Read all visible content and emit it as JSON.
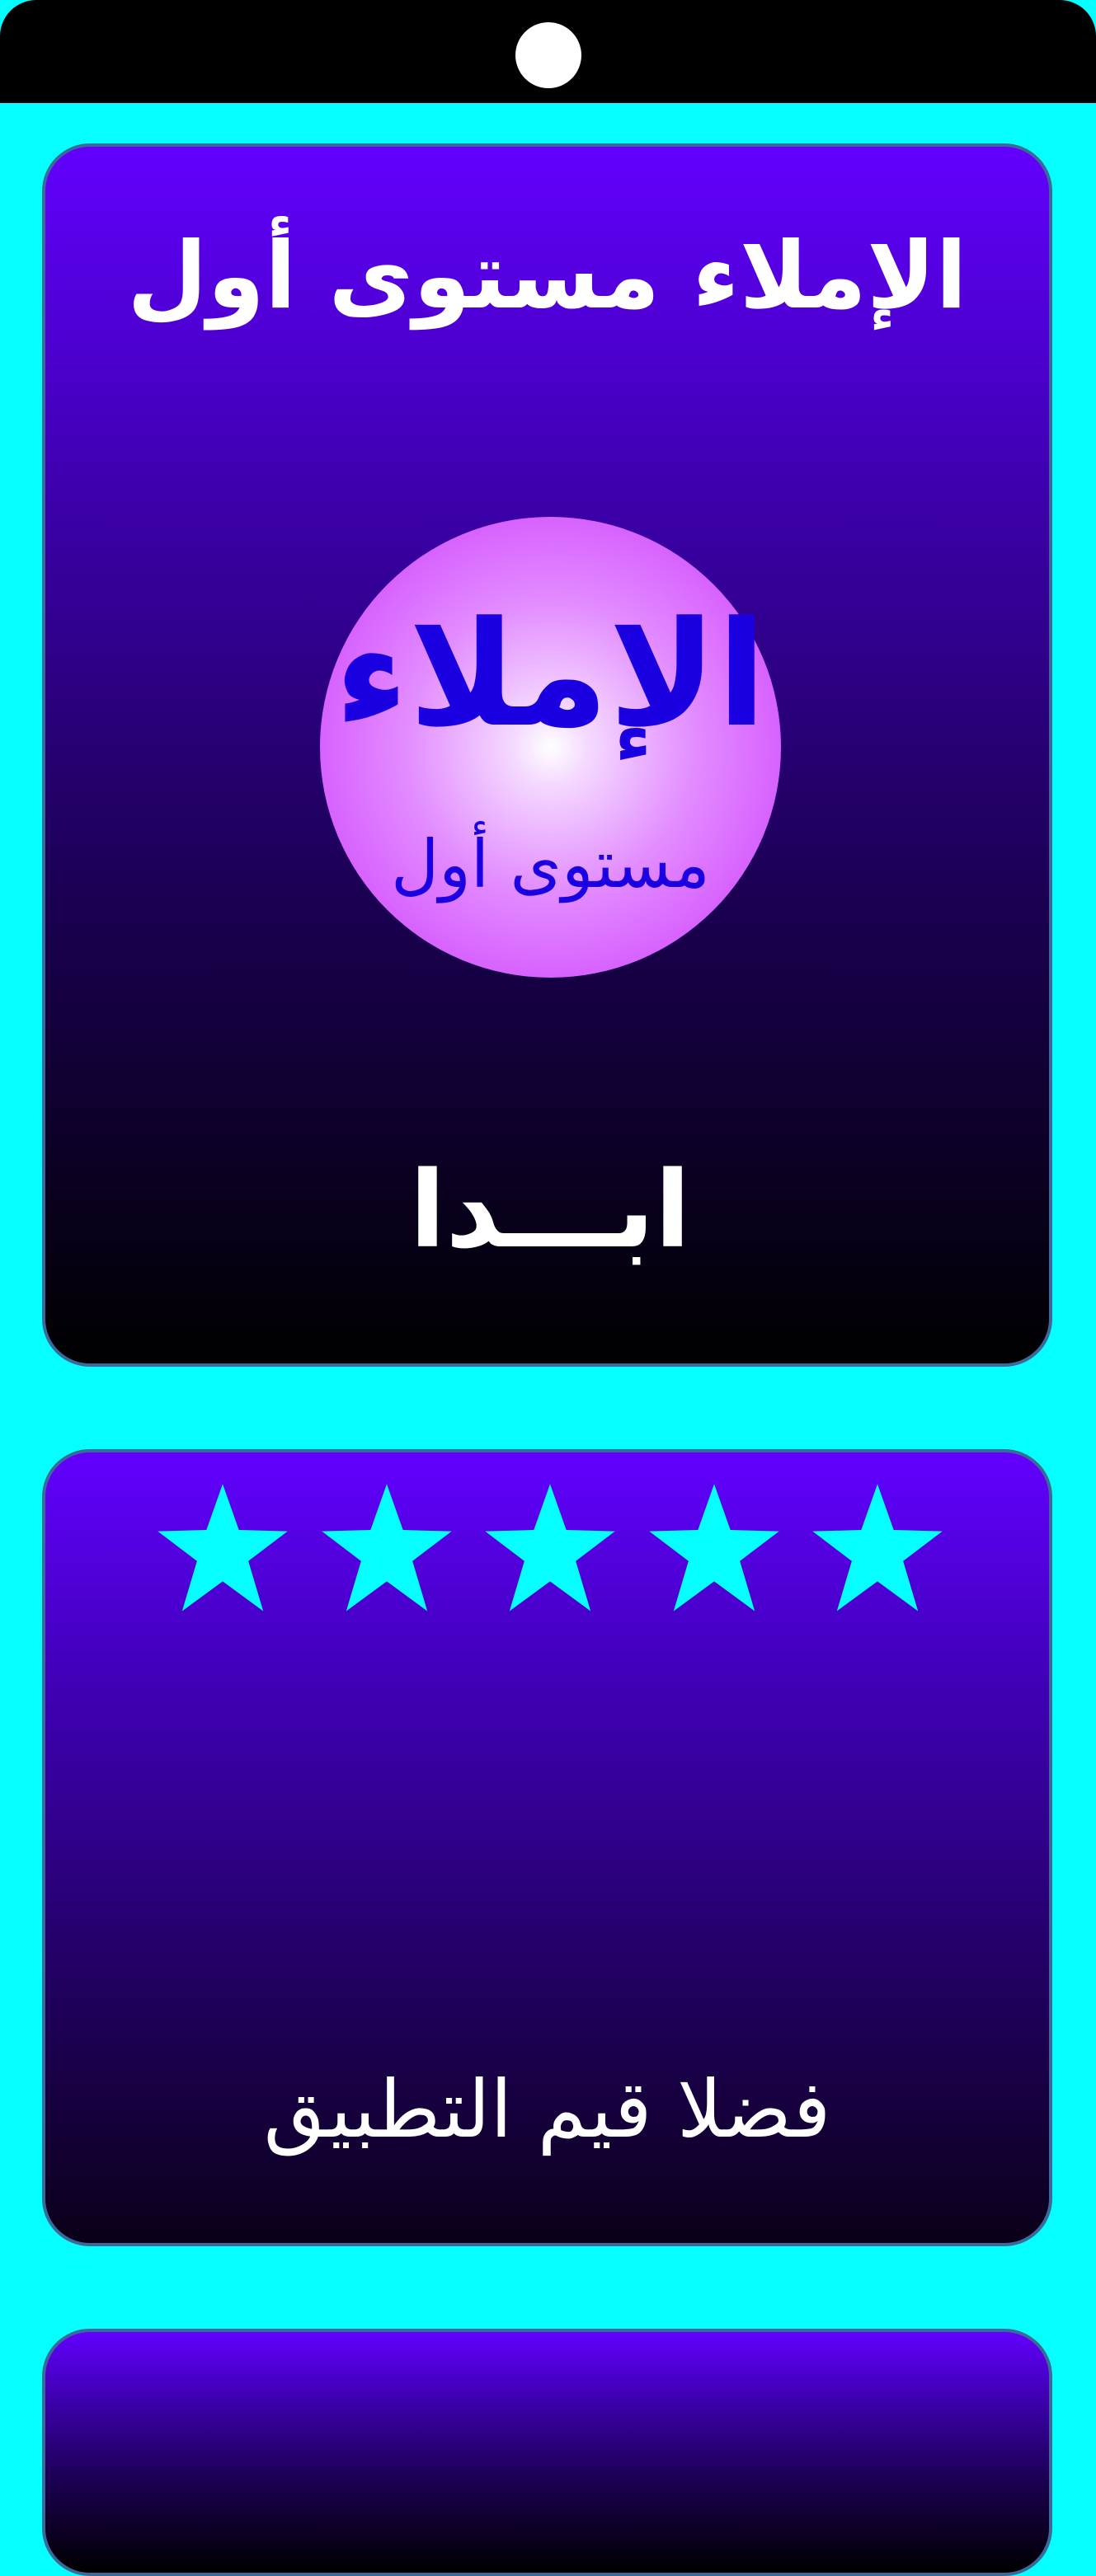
{
  "main_card": {
    "title": "الإملاء مستوى أول",
    "logo_title": "الإملاء",
    "logo_subtitle": "مستوى أول",
    "start_label": "ابـــدا"
  },
  "rating_card": {
    "stars": [
      {
        "icon": "star-icon"
      },
      {
        "icon": "star-icon"
      },
      {
        "icon": "star-icon"
      },
      {
        "icon": "star-icon"
      },
      {
        "icon": "star-icon"
      }
    ],
    "rate_label": "فضلا قيم التطبيق"
  },
  "colors": {
    "background": "#05FEFF",
    "card_top": "#6200FF",
    "card_bottom": "#000000",
    "star": "#05FEFF",
    "logo_text": "#1A00E0",
    "logo_circle": "#CC33FF"
  }
}
